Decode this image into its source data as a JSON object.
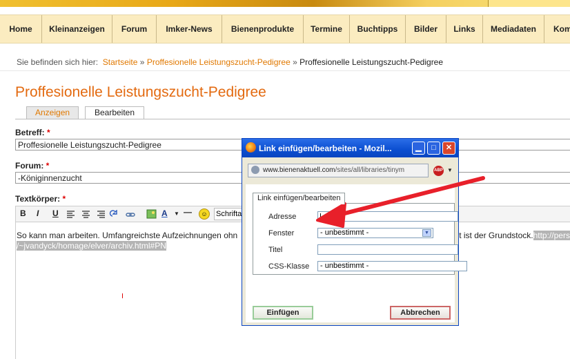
{
  "menu": [
    "Home",
    "Kleinanzeigen",
    "Forum",
    "Imker-News",
    "Bienenprodukte",
    "Termine",
    "Buchtipps",
    "Bilder",
    "Links",
    "Mediadaten",
    "Kom"
  ],
  "breadcrumb": {
    "prefix": "Sie befinden sich hier:",
    "home": "Startseite",
    "sep1": "»",
    "parent": "Proffesionelle Leistungszucht-Pedigree",
    "sep2": "»",
    "current": "Proffesionelle Leistungszucht-Pedigree"
  },
  "page_title": "Proffesionelle Leistungszucht-Pedigree",
  "tabs": {
    "view": "Anzeigen",
    "edit": "Bearbeiten"
  },
  "form": {
    "subject_label": "Betreff:",
    "subject_value": "Proffesionelle Leistungszucht-Pedigree",
    "forum_label": "Forum:",
    "forum_value": "-Königinnenzucht",
    "body_label": "Textkörper:",
    "required_mark": "*"
  },
  "toolbar": {
    "bold": "B",
    "italic": "I",
    "underline": "U",
    "font_label": "Schrifta"
  },
  "editor": {
    "text_before": "So kann man arbeiten. Umfangreichste Aufzeichnungen ohn",
    "text_after": "t ist der Grundstock.",
    "link_part1": "http://pers",
    "link_part2": "/~jvandyck/homage/elver/archiv.html#PN"
  },
  "dialog": {
    "title": "Link einfügen/bearbeiten - Mozil...",
    "url_domain": "www.bienenaktuell.com",
    "url_path": "/sites/all/libraries/tinym",
    "abp_label": "ABP",
    "tab": "Link einfügen/bearbeiten",
    "fields": {
      "address": "Adresse",
      "window": "Fenster",
      "window_value": "- unbestimmt -",
      "title": "Titel",
      "css_class": "CSS-Klasse",
      "css_value": "- unbestimmt -"
    },
    "insert": "Einfügen",
    "cancel": "Abbrechen"
  },
  "colors": {
    "accent": "#e36a10",
    "link": "#e07800",
    "menu_bg": "#fbecc0",
    "annotation_arrow": "#e8202a"
  }
}
